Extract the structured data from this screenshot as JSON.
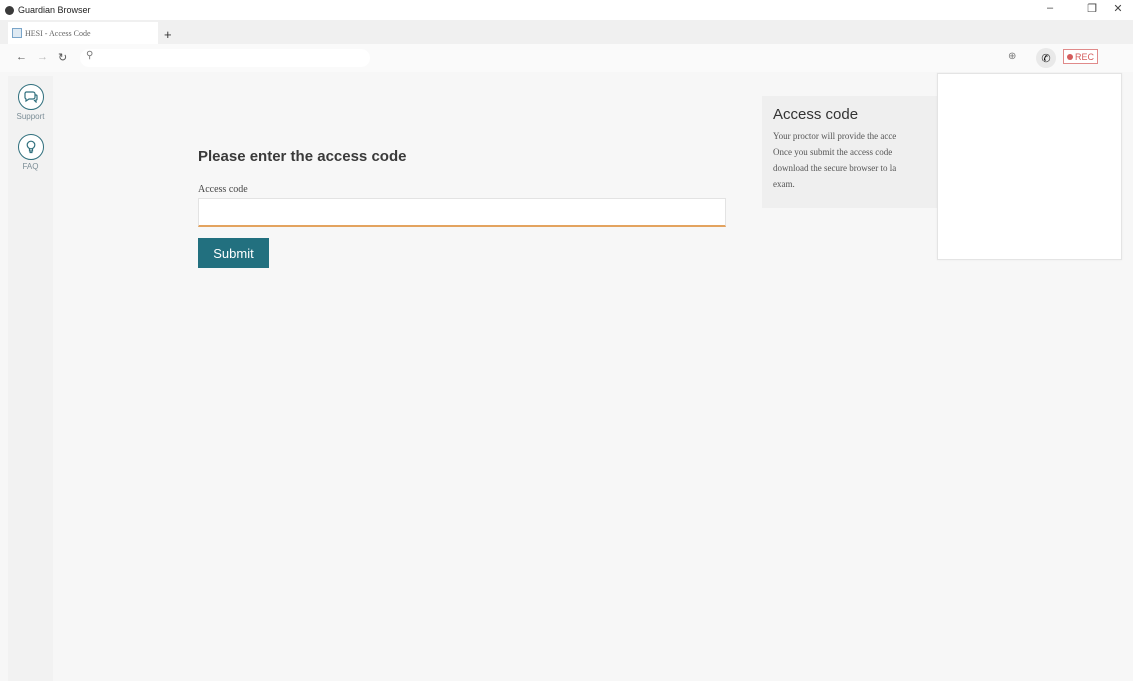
{
  "window": {
    "title": "Guardian Browser",
    "controls": {
      "minimize": "–",
      "restore": "❐",
      "close": "✕"
    }
  },
  "tabs": [
    {
      "title": "HESI - Access Code"
    }
  ],
  "new_tab_label": "+",
  "navbar": {
    "back": "←",
    "forward": "→",
    "reload": "↻",
    "search_icon": "⚲",
    "zoom_icon": "⊕",
    "phone_icon": "✆",
    "rec_label": "REC"
  },
  "sidebar": {
    "items": [
      {
        "label": "Support",
        "icon": "chat-icon",
        "glyph": "☏"
      },
      {
        "label": "FAQ",
        "icon": "lightbulb-icon",
        "glyph": "✎"
      }
    ]
  },
  "form": {
    "heading": "Please enter the access code",
    "field_label": "Access code",
    "field_value": "",
    "submit_label": "Submit"
  },
  "info_panel": {
    "title": "Access code",
    "lines": [
      "Your proctor will provide the acce",
      "Once you submit the access code",
      "download the secure browser to la",
      "exam."
    ]
  },
  "colors": {
    "accent": "#22707f",
    "input_focus": "#e3a35f",
    "rec": "#d45c5c"
  }
}
